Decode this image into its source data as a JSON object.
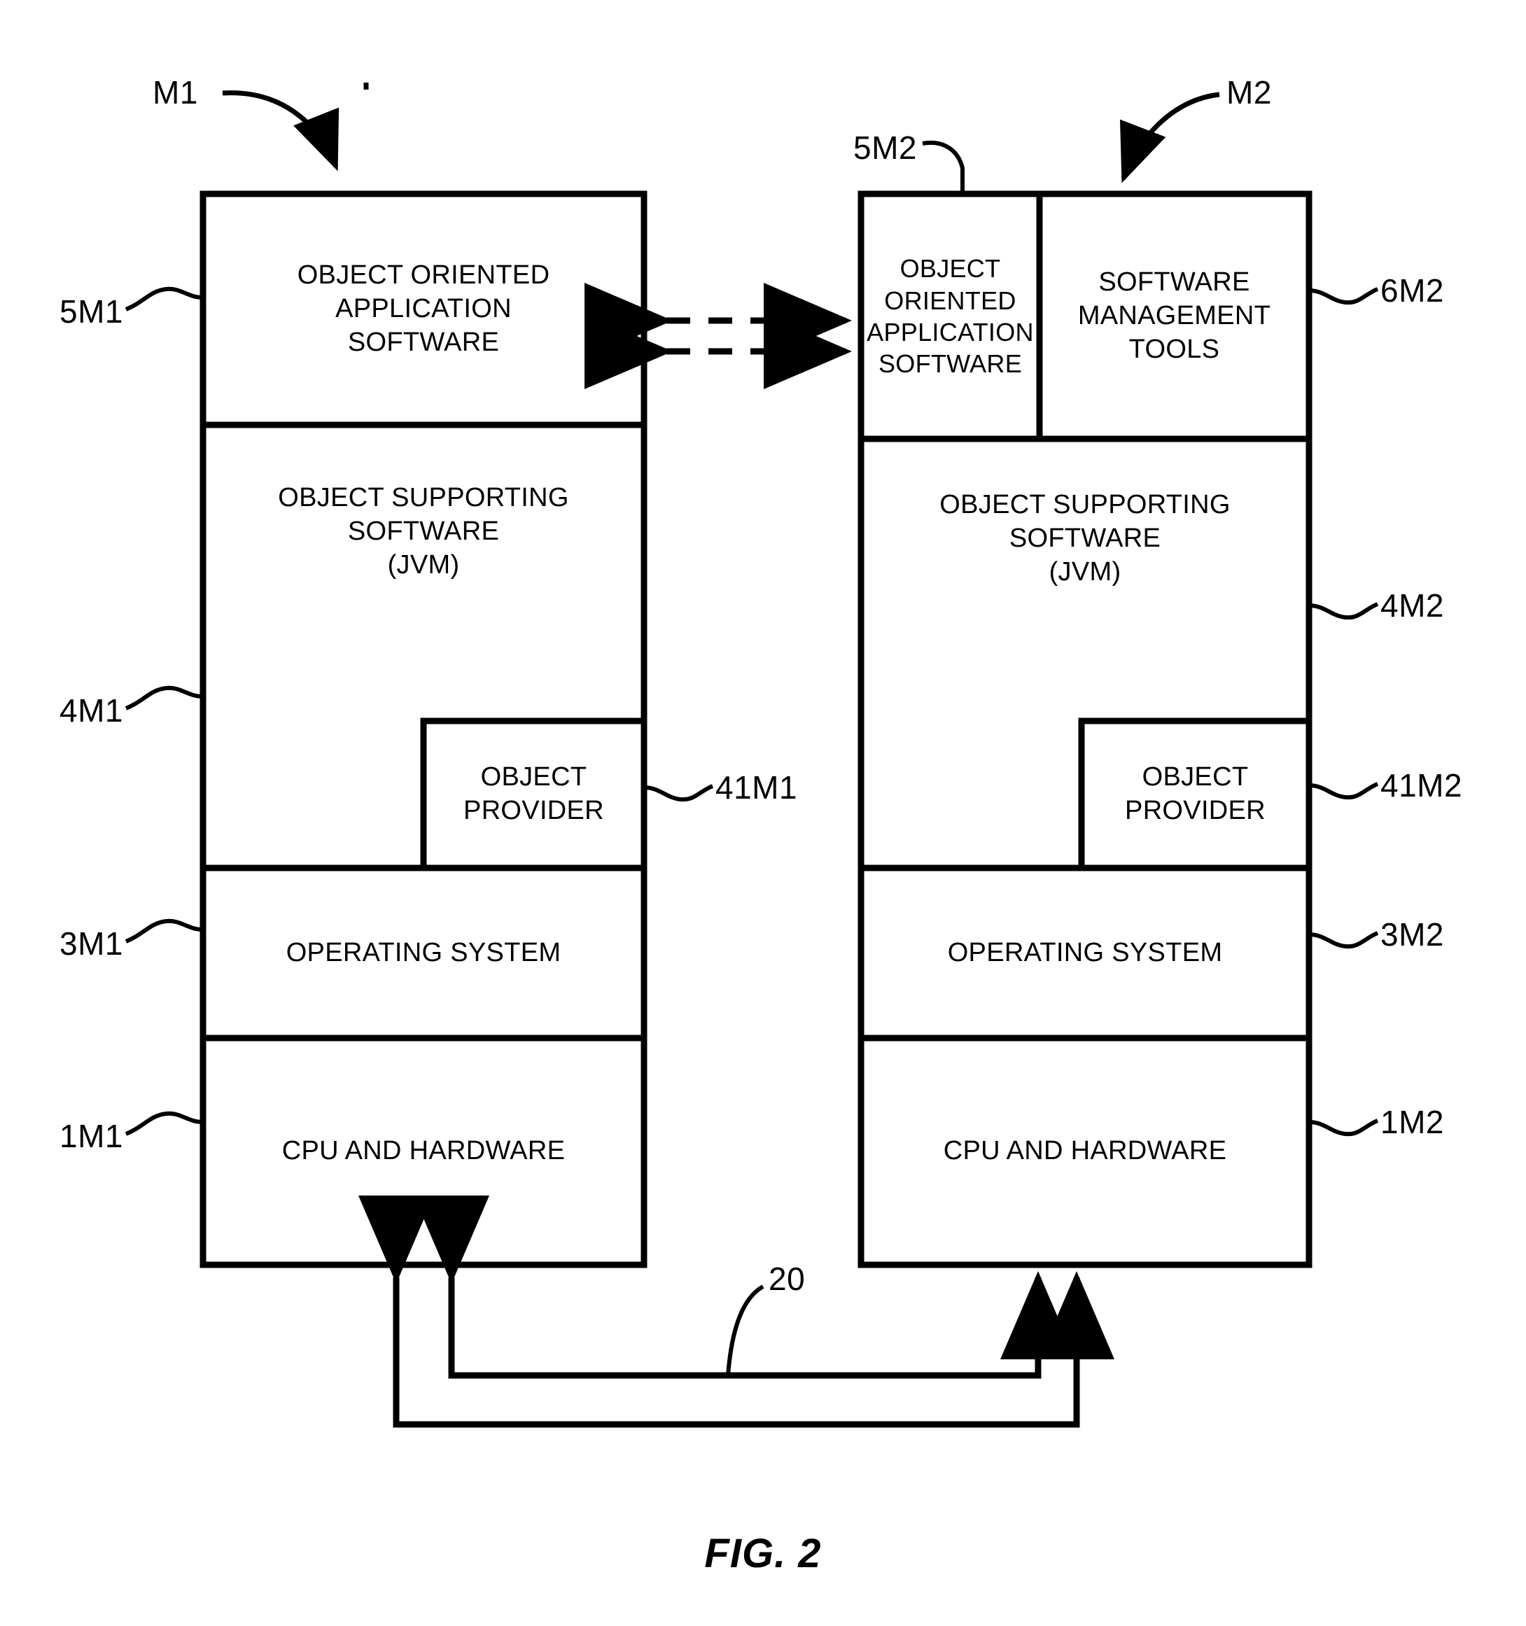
{
  "figure": {
    "caption": "FIG. 2",
    "machines": [
      {
        "callout": "M1",
        "layers": [
          {
            "ref": "5M1",
            "label": "OBJECT ORIENTED\nAPPLICATION\nSOFTWARE"
          },
          {
            "ref": "4M1",
            "label": "OBJECT SUPPORTING\nSOFTWARE\n(JVM)"
          },
          {
            "ref": "3M1",
            "label": "OPERATING SYSTEM"
          },
          {
            "ref": "1M1",
            "label": "CPU AND HARDWARE"
          }
        ],
        "nested": {
          "ref": "41M1",
          "label": "OBJECT\nPROVIDER"
        }
      },
      {
        "callout": "M2",
        "layers": [
          {
            "ref": "5M2",
            "label": "OBJECT\nORIENTED\nAPPLICATION\nSOFTWARE"
          },
          {
            "ref": "6M2",
            "label": "SOFTWARE\nMANAGEMENT\nTOOLS"
          },
          {
            "ref": "4M2",
            "label": "OBJECT SUPPORTING\nSOFTWARE\n(JVM)"
          },
          {
            "ref": "3M2",
            "label": "OPERATING SYSTEM"
          },
          {
            "ref": "1M2",
            "label": "CPU AND HARDWARE"
          }
        ],
        "nested": {
          "ref": "41M2",
          "label": "OBJECT\nPROVIDER"
        }
      }
    ],
    "network": {
      "ref": "20"
    },
    "line_color": "#000000"
  }
}
